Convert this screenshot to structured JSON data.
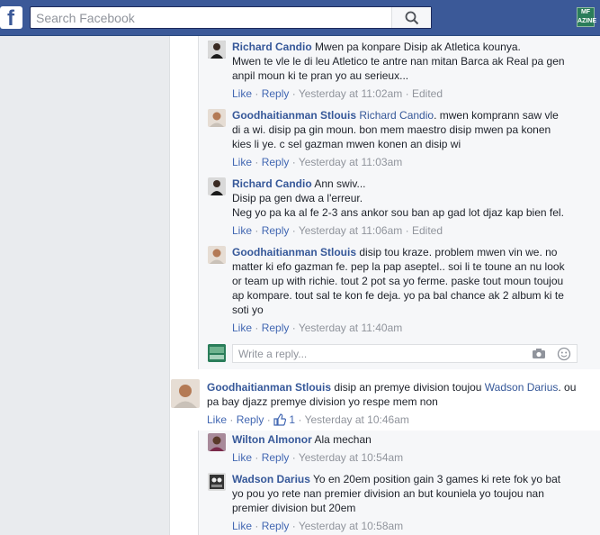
{
  "header": {
    "logo": "f",
    "search_placeholder": "Search Facebook",
    "brand_badge": "MF\nAZINE"
  },
  "comments": [
    {
      "author": "Richard Candio",
      "lines": [
        "Mwen pa konpare Disip ak Atletica kounya.",
        "Mwen te vle le di leu Atletico te antre nan mitan Barca ak Real pa gen",
        "anpil moun ki te pran yo au serieux..."
      ],
      "like": "Like",
      "reply": "Reply",
      "time": "Yesterday at 11:02am",
      "edited": "Edited"
    },
    {
      "author": "Goodhaitianman Stlouis",
      "mention": "Richard Candio",
      "line1_rest": ". mwen komprann saw vle",
      "lines": [
        "di a wi. disip pa gin moun. bon mem maestro disip mwen pa konen",
        "kies li ye. c sel gazman mwen konen an disip wi"
      ],
      "like": "Like",
      "reply": "Reply",
      "time": "Yesterday at 11:03am"
    },
    {
      "author": "Richard Candio",
      "line1_rest": "Ann swiv...",
      "lines": [
        "Disip pa gen dwa a l'erreur.",
        "Neg yo pa ka al fe 2-3 ans ankor sou ban ap gad lot djaz kap bien fel."
      ],
      "like": "Like",
      "reply": "Reply",
      "time": "Yesterday at 11:06am",
      "edited": "Edited"
    },
    {
      "author": "Goodhaitianman Stlouis",
      "line1_rest": "disip tou kraze. problem mwen vin we. no",
      "lines": [
        "matter ki efo gazman fe. pep la pap aseptel.. soi li te toune an nu look",
        "or team up with richie. tout 2 pot sa yo ferme. paske tout moun toujou",
        "ap kompare. tout sal te kon fe deja. yo pa bal chance ak 2 album ki te",
        "soti yo"
      ],
      "like": "Like",
      "reply": "Reply",
      "time": "Yesterday at 11:40am"
    },
    {
      "author": "Goodhaitianman Stlouis",
      "line1_rest": "disip an premye division toujou",
      "mention": "Wadson Darius",
      "mention_after": ". ou",
      "lines": [
        "pa bay djazz premye division yo respe mem non"
      ],
      "like": "Like",
      "reply": "Reply",
      "likes_count": "1",
      "time": "Yesterday at 10:46am"
    },
    {
      "author": "Wilton Almonor",
      "line1_rest": "Ala mechan",
      "like": "Like",
      "reply": "Reply",
      "time": "Yesterday at 10:54am"
    },
    {
      "author": "Wadson Darius",
      "line1_rest": "Yo en 20em position gain 3 games ki rete fok yo bat",
      "lines": [
        "yo pou yo rete nan premier division an but kouniela yo toujou nan",
        "premier division but 20em"
      ],
      "like": "Like",
      "reply": "Reply",
      "time": "Yesterday at 10:58am"
    }
  ],
  "reply_box": {
    "placeholder": "Write a reply..."
  },
  "sep": "·",
  "colors": {
    "header": "#3b5998",
    "link": "#365899",
    "action": "#4267b2",
    "meta": "#90949c"
  }
}
